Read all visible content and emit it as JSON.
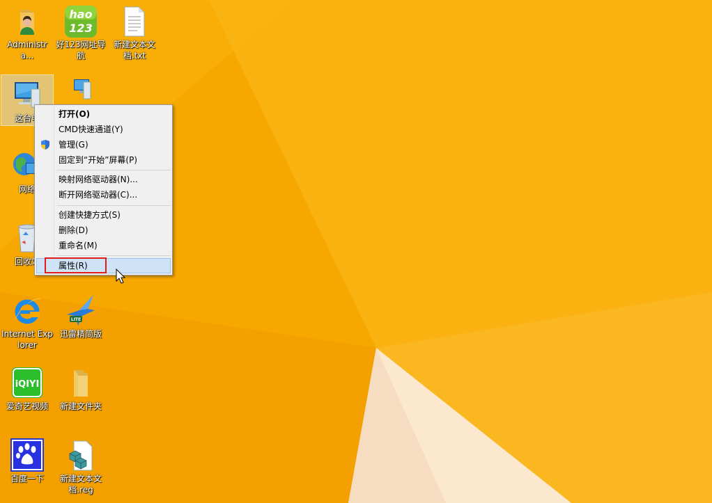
{
  "desktop": {
    "background_color": "#f7a900",
    "icons": [
      {
        "label": "Administra..."
      },
      {
        "label": "好123网址导航"
      },
      {
        "label": "新建文本文档.txt"
      },
      {
        "label": "这台电"
      },
      {
        "label": ""
      },
      {
        "label": "网络"
      },
      {
        "label": "回收站"
      },
      {
        "label": "Internet Explorer"
      },
      {
        "label": "迅雷精简版"
      },
      {
        "label": "爱奇艺视频"
      },
      {
        "label": "新建文件夹"
      },
      {
        "label": "百度一下"
      },
      {
        "label": "新建文本文档.reg"
      }
    ],
    "hao123_logo_text": "hao 123",
    "iqiyi_logo_text": "iQIYI",
    "lite_badge_text": "LITE"
  },
  "context_menu": {
    "items": [
      {
        "label": "打开(O)"
      },
      {
        "label": "CMD快速通道(Y)"
      },
      {
        "label": "管理(G)",
        "icon": "uac-shield-icon"
      },
      {
        "label": "固定到“开始”屏幕(P)"
      },
      {
        "label": "映射网络驱动器(N)..."
      },
      {
        "label": "断开网络驱动器(C)..."
      },
      {
        "label": "创建快捷方式(S)"
      },
      {
        "label": "删除(D)"
      },
      {
        "label": "重命名(M)"
      },
      {
        "label": "属性(R)"
      }
    ]
  },
  "colors": {
    "highlight_border": "#e21a1a",
    "menu_hover": "#cfe3f8"
  }
}
